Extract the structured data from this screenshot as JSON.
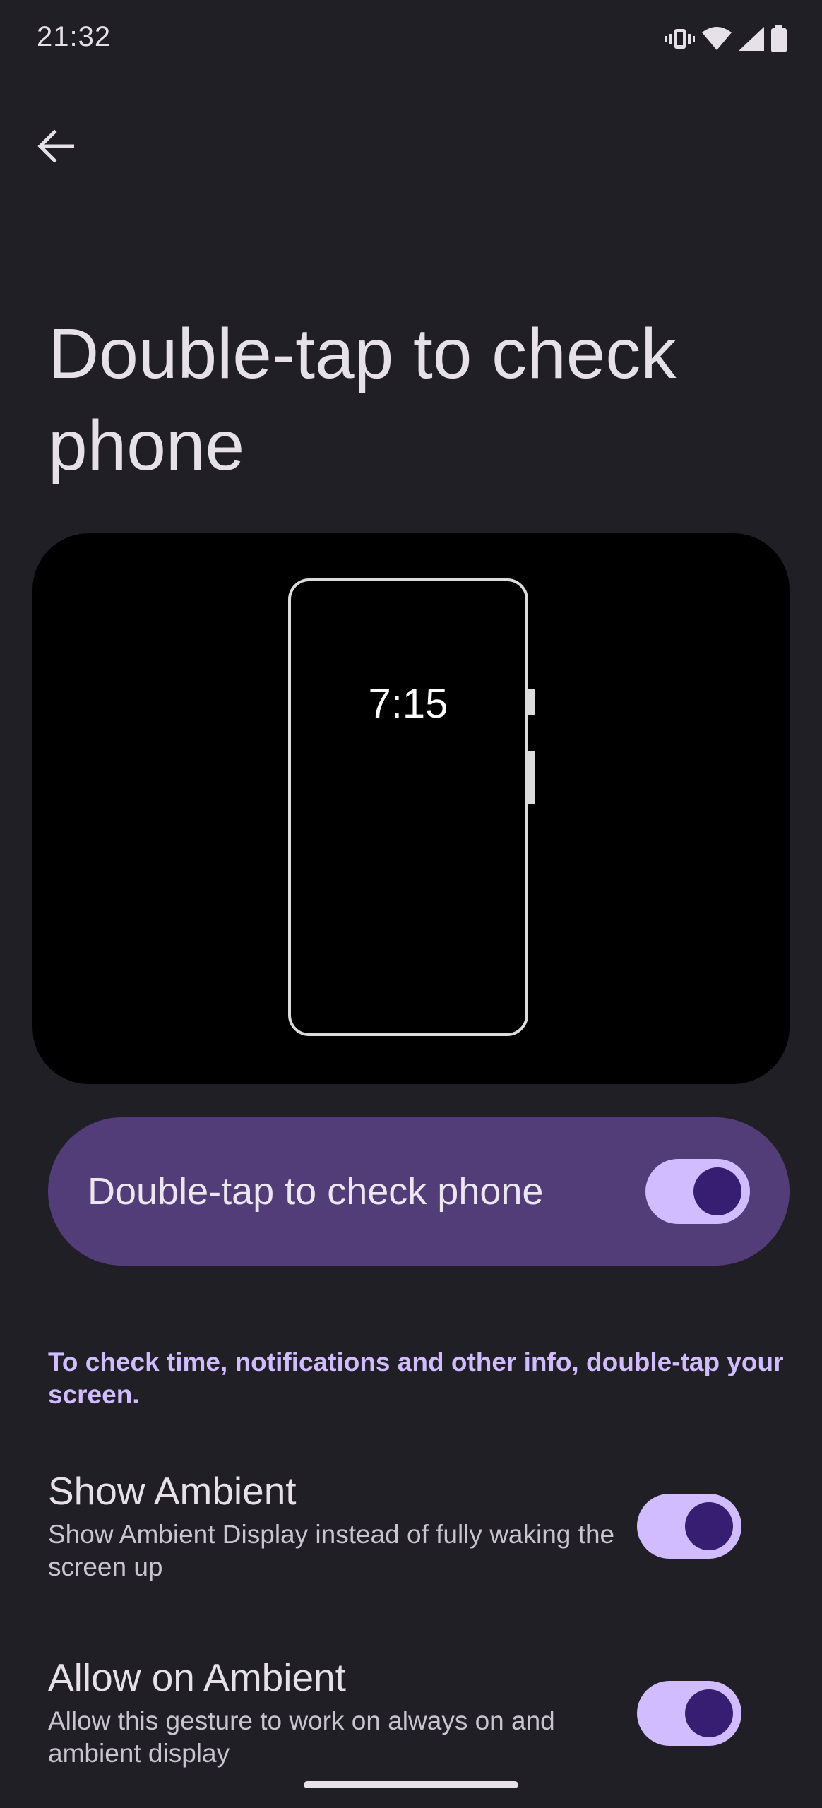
{
  "status_bar": {
    "time": "21:32",
    "icons": [
      "vibrate-icon",
      "wifi-icon",
      "cell-signal-icon",
      "battery-icon"
    ]
  },
  "header": {
    "back_icon": "arrow-back-icon"
  },
  "page": {
    "title": "Double-tap to check phone"
  },
  "illustration": {
    "clock": "7:15"
  },
  "main_toggle": {
    "label": "Double-tap to check phone",
    "checked": true
  },
  "description": "To check time, notifications and other info, double-tap your screen.",
  "settings": [
    {
      "title": "Show Ambient",
      "summary": "Show Ambient Display instead of fully waking the screen up",
      "checked": true
    },
    {
      "title": "Allow on Ambient",
      "summary": "Allow this gesture to work on always on and ambient display",
      "checked": true
    }
  ],
  "colors": {
    "background": "#211f26",
    "accent": "#d0bcff",
    "card": "#523d79",
    "thumb": "#381e72"
  }
}
